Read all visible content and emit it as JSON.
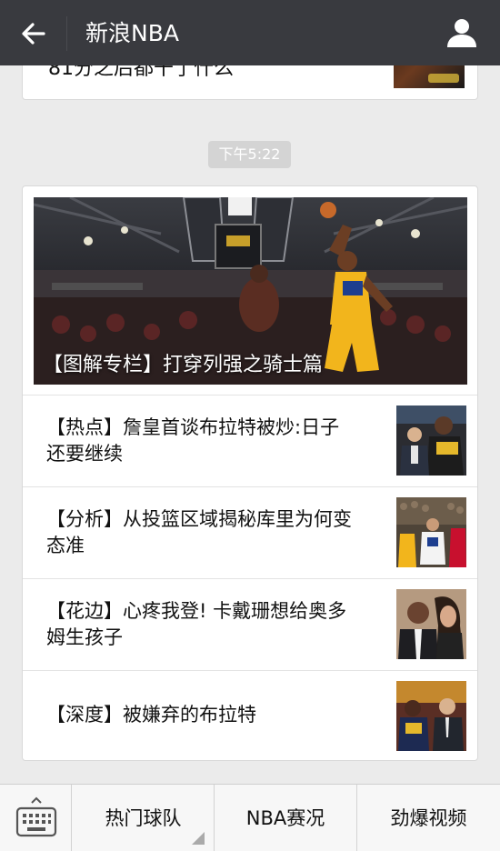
{
  "header": {
    "title": "新浪NBA",
    "back_icon": "arrow-left-icon",
    "profile_icon": "person-icon"
  },
  "previous_message": {
    "text": "81分之后都干了什么"
  },
  "timestamp": "下午5:22",
  "article_card": {
    "cover_title": "【图解专栏】打穿列强之骑士篇",
    "items": [
      {
        "title": "【热点】詹皇首谈布拉特被炒:日子还要继续"
      },
      {
        "title": "【分析】从投篮区域揭秘库里为何变态准"
      },
      {
        "title": "【花边】心疼我登! 卡戴珊想给奥多姆生孩子"
      },
      {
        "title": "【深度】被嫌弃的布拉特"
      }
    ]
  },
  "bottom_menu": {
    "keyboard_icon": "keyboard-icon",
    "items": [
      {
        "label": "热门球队"
      },
      {
        "label": "NBA赛况"
      },
      {
        "label": "劲爆视频"
      }
    ]
  },
  "colors": {
    "header_bg": "#393a3f",
    "page_bg": "#ebebeb",
    "warriors_yellow": "#f2b51c"
  }
}
